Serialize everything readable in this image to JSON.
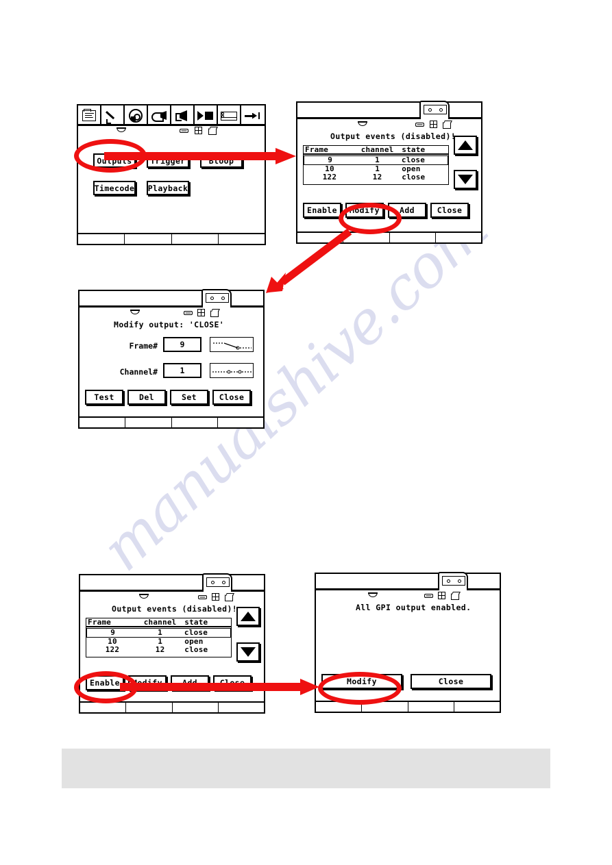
{
  "document": {
    "watermark": "manualshive.com",
    "accent_color": "#ee1111",
    "band_color": "#e2e2e2"
  },
  "panel_menu": {
    "name": "main-menu-screen",
    "toolbar": [
      {
        "icon": "document-icon",
        "label": "document"
      },
      {
        "icon": "pen-tool-icon",
        "label": "pen"
      },
      {
        "icon": "disc-icon",
        "label": "disc"
      },
      {
        "icon": "camera-icon",
        "label": "camera"
      },
      {
        "icon": "speaker-icon",
        "label": "speaker"
      },
      {
        "icon": "play-stop-icon",
        "label": "play-stop"
      },
      {
        "icon": "cassette-icon",
        "label": "cassette"
      },
      {
        "icon": "arrow-to-end-icon",
        "label": "arrow-to-end"
      }
    ],
    "status_glyphs": [
      "satellite-dish-icon",
      "battery-icon",
      "grid-icon",
      "page-icon"
    ],
    "buttons": [
      {
        "label": "Outputs",
        "highlighted": true
      },
      {
        "label": "Trigger",
        "highlighted": false
      },
      {
        "label": "Bloop",
        "highlighted": false
      },
      {
        "label": "Timecode",
        "highlighted": false
      },
      {
        "label": "Playback",
        "highlighted": false
      }
    ]
  },
  "panel_events_top": {
    "name": "output-events-screen",
    "title": "Output events (disabled)!",
    "status_glyphs": [
      "satellite-dish-icon",
      "battery-icon",
      "grid-icon",
      "page-icon"
    ],
    "table": {
      "headers": [
        "Frame",
        "channel",
        "state"
      ],
      "rows": [
        {
          "frame": "9",
          "channel": "1",
          "state": "close",
          "selected": true
        },
        {
          "frame": "10",
          "channel": "1",
          "state": "open",
          "selected": false
        },
        {
          "frame": "122",
          "channel": "12",
          "state": "close",
          "selected": false
        }
      ]
    },
    "scroll_up": "scroll-up-arrow",
    "scroll_down": "scroll-down-arrow",
    "buttons": [
      {
        "label": "Enable",
        "highlighted": false
      },
      {
        "label": "Modify",
        "highlighted": true
      },
      {
        "label": "Add",
        "highlighted": false
      },
      {
        "label": "Close",
        "highlighted": false
      }
    ]
  },
  "panel_modify": {
    "name": "modify-output-screen",
    "title": "Modify output: 'CLOSE'",
    "status_glyphs": [
      "satellite-dish-icon",
      "battery-icon",
      "grid-icon",
      "page-icon"
    ],
    "fields": [
      {
        "label": "Frame#",
        "value": "9",
        "graph": "falling-edge-waveform"
      },
      {
        "label": "Channel#",
        "value": "1",
        "graph": "flat-line-waveform"
      }
    ],
    "buttons": [
      {
        "label": "Test",
        "highlighted": false
      },
      {
        "label": "Del",
        "highlighted": false
      },
      {
        "label": "Set",
        "highlighted": false
      },
      {
        "label": "Close",
        "highlighted": false
      }
    ]
  },
  "panel_events_bottom": {
    "name": "output-events-screen-2",
    "title": "Output events (disabled)!",
    "status_glyphs": [
      "satellite-dish-icon",
      "battery-icon",
      "grid-icon",
      "page-icon"
    ],
    "table": {
      "headers": [
        "Frame",
        "channel",
        "state"
      ],
      "rows": [
        {
          "frame": "9",
          "channel": "1",
          "state": "close",
          "selected": true
        },
        {
          "frame": "10",
          "channel": "1",
          "state": "open",
          "selected": false
        },
        {
          "frame": "122",
          "channel": "12",
          "state": "close",
          "selected": false
        }
      ]
    },
    "buttons": [
      {
        "label": "Enable",
        "highlighted": true
      },
      {
        "label": "Modify",
        "highlighted": false
      },
      {
        "label": "Add",
        "highlighted": false
      },
      {
        "label": "Close",
        "highlighted": false
      }
    ]
  },
  "panel_gpi": {
    "name": "gpi-enabled-screen",
    "title": "All GPI output enabled.",
    "status_glyphs": [
      "satellite-dish-icon",
      "battery-icon",
      "grid-icon",
      "page-icon"
    ],
    "buttons": [
      {
        "label": "Modify",
        "highlighted": true
      },
      {
        "label": "Close",
        "highlighted": false
      }
    ]
  },
  "annotations": {
    "ovals": [
      {
        "target": "Outputs"
      },
      {
        "target": "Modify"
      },
      {
        "target": "Enable"
      },
      {
        "target": "Modify"
      }
    ],
    "arrows": [
      {
        "from": "Outputs",
        "to": "output-events-screen",
        "direction": "right"
      },
      {
        "from": "Modify",
        "to": "modify-output-screen",
        "direction": "down-left"
      },
      {
        "from": "Enable",
        "to": "gpi-enabled-screen",
        "direction": "right"
      }
    ]
  }
}
